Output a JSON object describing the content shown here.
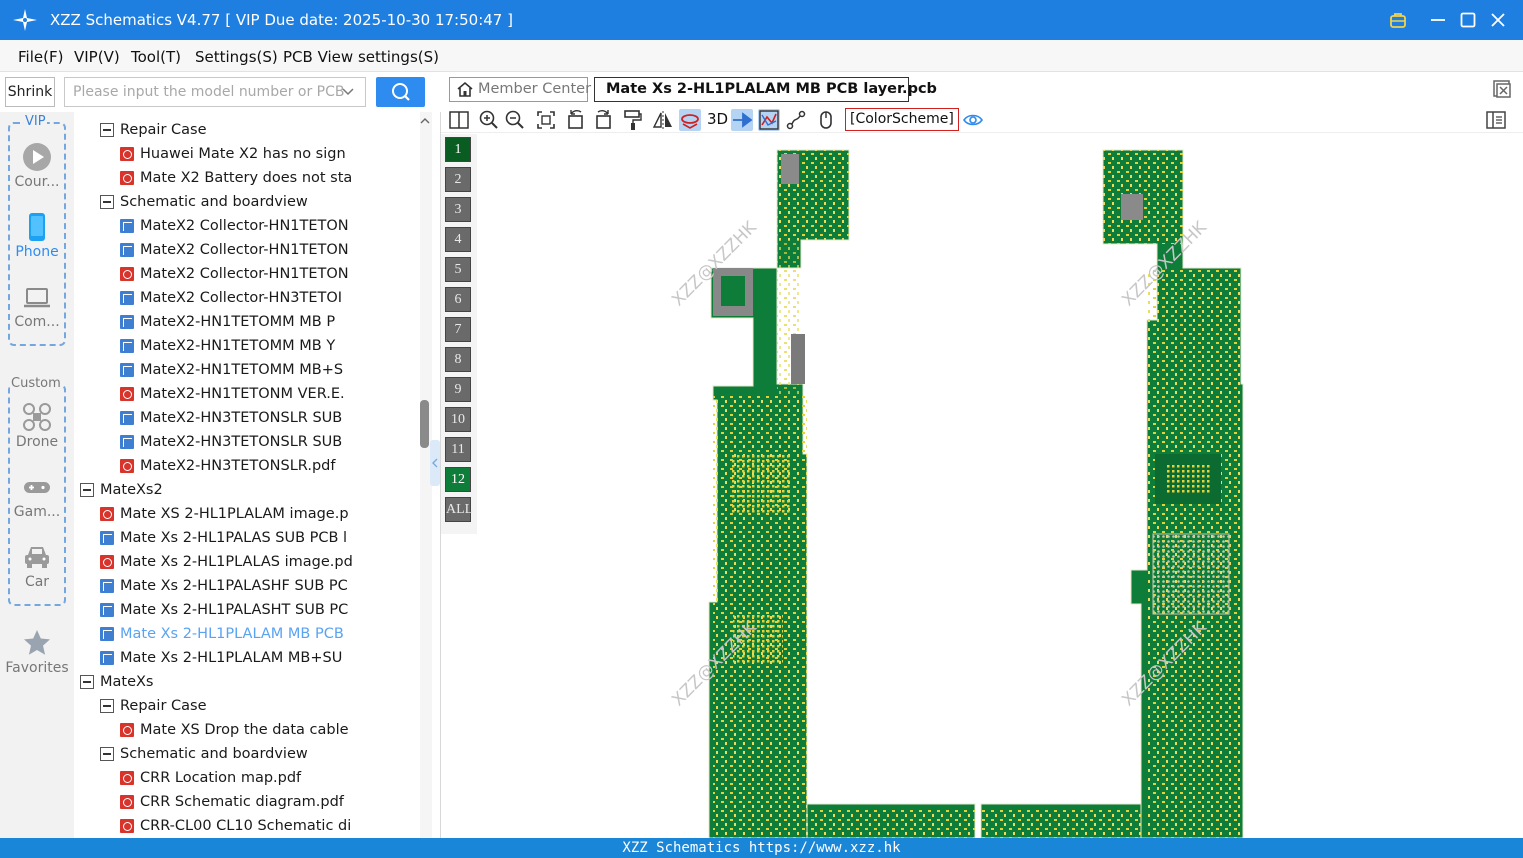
{
  "window": {
    "title": "XZZ Schematics V4.77 [ VIP Due date: 2025-10-30 17:50:47 ]"
  },
  "menu": [
    "File(F)",
    "VIP(V)",
    "Tool(T)",
    "Settings(S)",
    "PCB View settings(S)"
  ],
  "search": {
    "shrink_label": "Shrink",
    "placeholder": "Please input the model number or PCB"
  },
  "categories": {
    "vip_label": "VIP",
    "custom_label": "Custom",
    "items": [
      {
        "label": "Cour...",
        "icon": "play-icon"
      },
      {
        "label": "Phone",
        "icon": "phone-icon"
      },
      {
        "label": "Com...",
        "icon": "laptop-icon"
      },
      {
        "label": "Drone",
        "icon": "drone-icon"
      },
      {
        "label": "Gam...",
        "icon": "gamepad-icon"
      },
      {
        "label": "Car",
        "icon": "car-icon"
      },
      {
        "label": "Favorites",
        "icon": "star-icon"
      }
    ],
    "active": "Phone"
  },
  "tree": [
    {
      "level": 2,
      "type": "folder",
      "label": "Repair Case"
    },
    {
      "level": 3,
      "type": "pdf",
      "label": "Huawei Mate X2 has no sign"
    },
    {
      "level": 3,
      "type": "pdf",
      "label": "Mate X2 Battery does not sta"
    },
    {
      "level": 2,
      "type": "folder",
      "label": "Schematic and boardview"
    },
    {
      "level": 3,
      "type": "pcb",
      "label": "MateX2 Collector-HN1TETON"
    },
    {
      "level": 3,
      "type": "pcb",
      "label": "MateX2 Collector-HN1TETON"
    },
    {
      "level": 3,
      "type": "pdf",
      "label": "MateX2 Collector-HN1TETON"
    },
    {
      "level": 3,
      "type": "pcb",
      "label": "MateX2 Collector-HN3TETOI"
    },
    {
      "level": 3,
      "type": "pcb",
      "label": "MateX2-HN1TETOMM MB P"
    },
    {
      "level": 3,
      "type": "pcb",
      "label": "MateX2-HN1TETOMM MB Y"
    },
    {
      "level": 3,
      "type": "pcb",
      "label": "MateX2-HN1TETOMM MB+S"
    },
    {
      "level": 3,
      "type": "pdf",
      "label": "MateX2-HN1TETONM VER.E."
    },
    {
      "level": 3,
      "type": "pcb",
      "label": "MateX2-HN3TETONSLR SUB"
    },
    {
      "level": 3,
      "type": "pcb",
      "label": "MateX2-HN3TETONSLR SUB"
    },
    {
      "level": 3,
      "type": "pdf",
      "label": "MateX2-HN3TETONSLR.pdf"
    },
    {
      "level": 1,
      "type": "folder",
      "label": "MateXs2"
    },
    {
      "level": 2,
      "type": "pdf",
      "label": "Mate XS 2-HL1PLALAM image.p"
    },
    {
      "level": 2,
      "type": "pcb",
      "label": "Mate Xs 2-HL1PALAS SUB PCB l"
    },
    {
      "level": 2,
      "type": "pdf",
      "label": "Mate Xs 2-HL1PLALAS image.pd"
    },
    {
      "level": 2,
      "type": "pcb",
      "label": "Mate Xs 2-HL1PALASHF SUB PC"
    },
    {
      "level": 2,
      "type": "pcb",
      "label": "Mate Xs 2-HL1PALASHT SUB PC"
    },
    {
      "level": 2,
      "type": "pcb",
      "label": "Mate Xs 2-HL1PLALAM MB PCB",
      "selected": true
    },
    {
      "level": 2,
      "type": "pcb",
      "label": "Mate Xs 2-HL1PLALAM MB+SU"
    },
    {
      "level": 1,
      "type": "folder",
      "label": "MateXs"
    },
    {
      "level": 2,
      "type": "folder",
      "label": "Repair Case"
    },
    {
      "level": 3,
      "type": "pdf",
      "label": "Mate XS Drop the data cable"
    },
    {
      "level": 2,
      "type": "folder",
      "label": "Schematic and boardview"
    },
    {
      "level": 3,
      "type": "pdf",
      "label": "CRR Location map.pdf"
    },
    {
      "level": 3,
      "type": "pdf",
      "label": "CRR Schematic diagram.pdf"
    },
    {
      "level": 3,
      "type": "pdf",
      "label": "CRR-CL00 CL10 Schematic di"
    }
  ],
  "tabs": {
    "member_center": "Member Center",
    "pcb_file": "Mate Xs 2-HL1PLALAM MB PCB layer.pcb"
  },
  "toolbar": {
    "three_d": "3D",
    "color_scheme": "[ColorScheme]",
    "icons": [
      "split-view-icon",
      "zoom-in-icon",
      "zoom-out-icon",
      "fit-view-icon",
      "rotate-left-icon",
      "rotate-right-icon",
      "paint-roller-icon",
      "mirror-icon",
      "flip-icon",
      "pin-icon",
      "network-icon",
      "route-icon",
      "mouse-icon",
      "eye-icon",
      "side-panel-icon"
    ]
  },
  "layers": [
    {
      "label": "1",
      "state": "current"
    },
    {
      "label": "2",
      "state": "off"
    },
    {
      "label": "3",
      "state": "off"
    },
    {
      "label": "4",
      "state": "off"
    },
    {
      "label": "5",
      "state": "off"
    },
    {
      "label": "6",
      "state": "off"
    },
    {
      "label": "7",
      "state": "off"
    },
    {
      "label": "8",
      "state": "off"
    },
    {
      "label": "9",
      "state": "off"
    },
    {
      "label": "10",
      "state": "off"
    },
    {
      "label": "11",
      "state": "off"
    },
    {
      "label": "12",
      "state": "on"
    },
    {
      "label": "ALL",
      "state": "off"
    }
  ],
  "watermark": "XZZ@XZZHK",
  "colors": {
    "titlebar": "#1e7fe0",
    "accent": "#2e8cf0",
    "pcb_green": "#0e7d3a",
    "pad_yellow": "#e2d33c",
    "selected_text": "#5aa3f2"
  },
  "status": "XZZ Schematics https://www.xzz.hk"
}
